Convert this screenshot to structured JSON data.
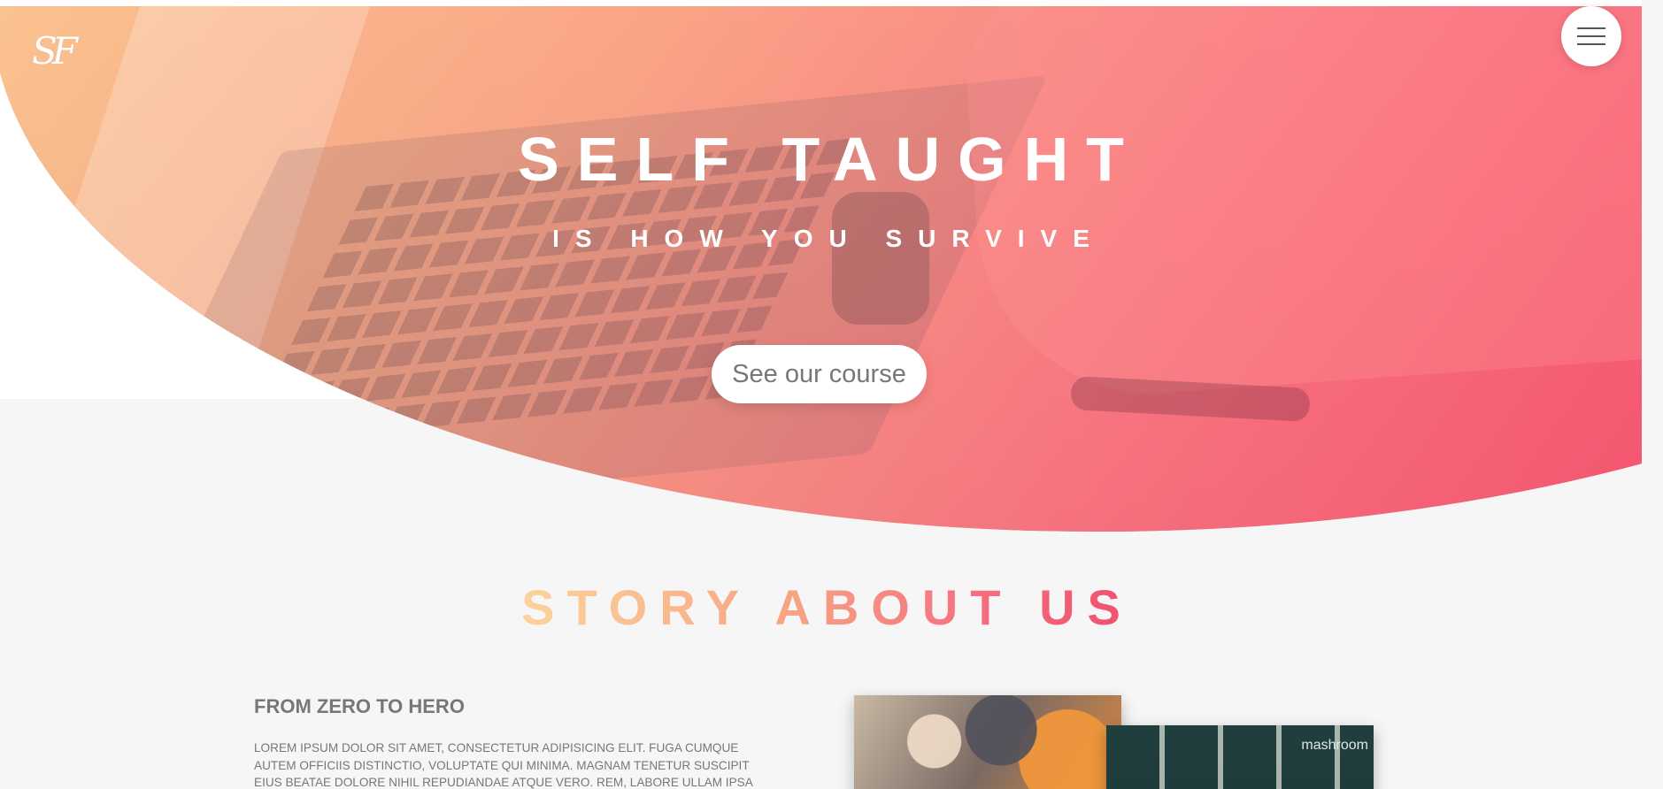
{
  "header": {
    "logo_text": "SF",
    "menu_icon": "hamburger-icon"
  },
  "hero": {
    "title": "SELF TAUGHT",
    "subtitle": "IS HOW YOU SURVIVE",
    "cta_label": "See our course",
    "gradient_colors": [
      "#ffc48c",
      "#ffa082",
      "#ff6e7d",
      "#fa506e"
    ]
  },
  "story": {
    "title": "STORY ABOUT US",
    "heading": "FROM ZERO TO HERO",
    "body": "Lorem ipsum dolor sit amet, consectetur adipisicing elit. Fuga cumque autem officiis distinctio, voluptate qui minima. Magnam tenetur suscipit eius beatae dolore nihil repudiandae atque vero. Rem, labore ullam ipsa incidunt enim id",
    "photo_two_sign": "mashroom"
  },
  "colors": {
    "background": "#f6f6f6",
    "text_gray": "#777777",
    "accent_start": "#fdd39b",
    "accent_end": "#f0506e"
  }
}
